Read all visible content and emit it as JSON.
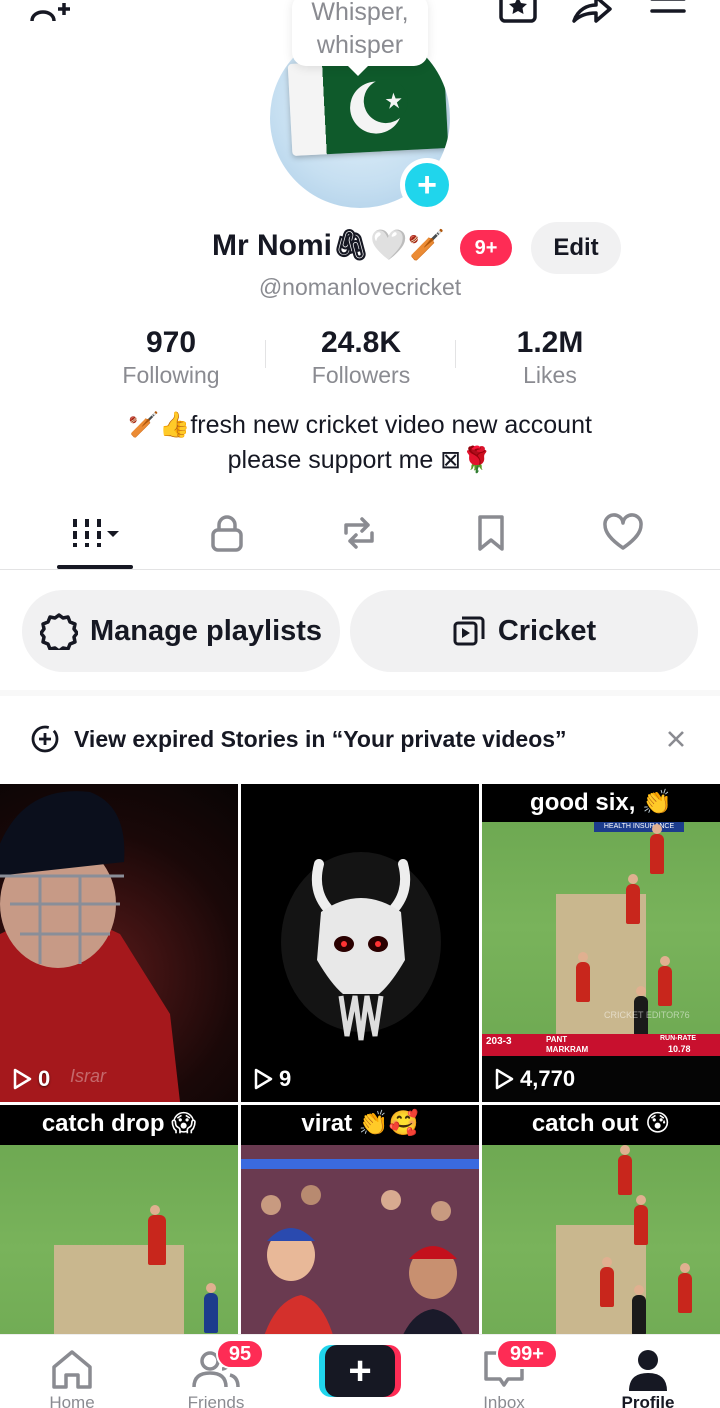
{
  "status_bubble": {
    "text": "Whisper, whisper"
  },
  "profile": {
    "name": "Mr Nomi",
    "name_emojis": "🖇🤍🏏",
    "notification_badge": "9+",
    "edit_label": "Edit",
    "handle": "@nomanlovecricket"
  },
  "stats": [
    {
      "value": "970",
      "label": "Following"
    },
    {
      "value": "24.8K",
      "label": "Followers"
    },
    {
      "value": "1.2M",
      "label": "Likes"
    }
  ],
  "bio": {
    "line1": "🏏👍fresh new cricket video new account",
    "line2": "please support me ⊠🌹"
  },
  "tabs": [
    {
      "name": "videos",
      "icon": "grid-icon",
      "active": true
    },
    {
      "name": "private",
      "icon": "lock-icon"
    },
    {
      "name": "reposts",
      "icon": "repost-icon"
    },
    {
      "name": "favorites",
      "icon": "bookmark-icon"
    },
    {
      "name": "liked",
      "icon": "heart-icon"
    }
  ],
  "playlists": {
    "manage_label": "Manage playlists",
    "playlist_label": "Cricket"
  },
  "stories_banner": {
    "text": "View expired Stories in “Your private videos”"
  },
  "videos": [
    {
      "overlay": "",
      "views": "0",
      "watermark": "Israr"
    },
    {
      "overlay": "",
      "views": "9"
    },
    {
      "overlay": "good six, 👏",
      "views": "4,770",
      "scoreboard": "203-3",
      "run_rate_label": "RUN-RATE",
      "run_rate": "10.78",
      "batter": "PANT",
      "bowler": "MARKRAM",
      "banner": "HEALTH INSURANCE",
      "credit": "CRICKET EDITOR76"
    },
    {
      "overlay": "catch drop 😱",
      "views": ""
    },
    {
      "overlay": "virat 👏🥰",
      "views": ""
    },
    {
      "overlay": "catch out 😰",
      "views": ""
    }
  ],
  "bottom_nav": {
    "home": "Home",
    "friends": "Friends",
    "friends_badge": "95",
    "inbox": "Inbox",
    "inbox_badge": "99+",
    "profile": "Profile",
    "create_label": "+"
  },
  "colors": {
    "accent_red": "#fe2c55",
    "accent_cyan": "#20d5ec",
    "text_primary": "#161823",
    "text_secondary": "#8a8b91"
  }
}
